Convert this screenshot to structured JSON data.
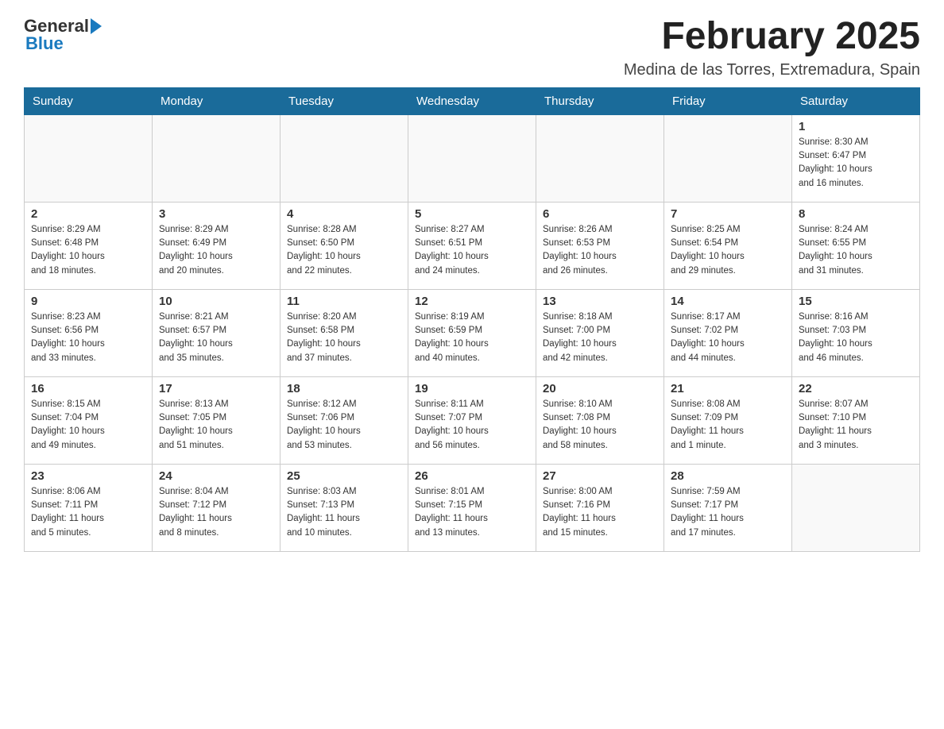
{
  "header": {
    "logo_general": "General",
    "logo_blue": "Blue",
    "title": "February 2025",
    "subtitle": "Medina de las Torres, Extremadura, Spain"
  },
  "calendar": {
    "days_of_week": [
      "Sunday",
      "Monday",
      "Tuesday",
      "Wednesday",
      "Thursday",
      "Friday",
      "Saturday"
    ],
    "weeks": [
      [
        {
          "day": "",
          "info": ""
        },
        {
          "day": "",
          "info": ""
        },
        {
          "day": "",
          "info": ""
        },
        {
          "day": "",
          "info": ""
        },
        {
          "day": "",
          "info": ""
        },
        {
          "day": "",
          "info": ""
        },
        {
          "day": "1",
          "info": "Sunrise: 8:30 AM\nSunset: 6:47 PM\nDaylight: 10 hours\nand 16 minutes."
        }
      ],
      [
        {
          "day": "2",
          "info": "Sunrise: 8:29 AM\nSunset: 6:48 PM\nDaylight: 10 hours\nand 18 minutes."
        },
        {
          "day": "3",
          "info": "Sunrise: 8:29 AM\nSunset: 6:49 PM\nDaylight: 10 hours\nand 20 minutes."
        },
        {
          "day": "4",
          "info": "Sunrise: 8:28 AM\nSunset: 6:50 PM\nDaylight: 10 hours\nand 22 minutes."
        },
        {
          "day": "5",
          "info": "Sunrise: 8:27 AM\nSunset: 6:51 PM\nDaylight: 10 hours\nand 24 minutes."
        },
        {
          "day": "6",
          "info": "Sunrise: 8:26 AM\nSunset: 6:53 PM\nDaylight: 10 hours\nand 26 minutes."
        },
        {
          "day": "7",
          "info": "Sunrise: 8:25 AM\nSunset: 6:54 PM\nDaylight: 10 hours\nand 29 minutes."
        },
        {
          "day": "8",
          "info": "Sunrise: 8:24 AM\nSunset: 6:55 PM\nDaylight: 10 hours\nand 31 minutes."
        }
      ],
      [
        {
          "day": "9",
          "info": "Sunrise: 8:23 AM\nSunset: 6:56 PM\nDaylight: 10 hours\nand 33 minutes."
        },
        {
          "day": "10",
          "info": "Sunrise: 8:21 AM\nSunset: 6:57 PM\nDaylight: 10 hours\nand 35 minutes."
        },
        {
          "day": "11",
          "info": "Sunrise: 8:20 AM\nSunset: 6:58 PM\nDaylight: 10 hours\nand 37 minutes."
        },
        {
          "day": "12",
          "info": "Sunrise: 8:19 AM\nSunset: 6:59 PM\nDaylight: 10 hours\nand 40 minutes."
        },
        {
          "day": "13",
          "info": "Sunrise: 8:18 AM\nSunset: 7:00 PM\nDaylight: 10 hours\nand 42 minutes."
        },
        {
          "day": "14",
          "info": "Sunrise: 8:17 AM\nSunset: 7:02 PM\nDaylight: 10 hours\nand 44 minutes."
        },
        {
          "day": "15",
          "info": "Sunrise: 8:16 AM\nSunset: 7:03 PM\nDaylight: 10 hours\nand 46 minutes."
        }
      ],
      [
        {
          "day": "16",
          "info": "Sunrise: 8:15 AM\nSunset: 7:04 PM\nDaylight: 10 hours\nand 49 minutes."
        },
        {
          "day": "17",
          "info": "Sunrise: 8:13 AM\nSunset: 7:05 PM\nDaylight: 10 hours\nand 51 minutes."
        },
        {
          "day": "18",
          "info": "Sunrise: 8:12 AM\nSunset: 7:06 PM\nDaylight: 10 hours\nand 53 minutes."
        },
        {
          "day": "19",
          "info": "Sunrise: 8:11 AM\nSunset: 7:07 PM\nDaylight: 10 hours\nand 56 minutes."
        },
        {
          "day": "20",
          "info": "Sunrise: 8:10 AM\nSunset: 7:08 PM\nDaylight: 10 hours\nand 58 minutes."
        },
        {
          "day": "21",
          "info": "Sunrise: 8:08 AM\nSunset: 7:09 PM\nDaylight: 11 hours\nand 1 minute."
        },
        {
          "day": "22",
          "info": "Sunrise: 8:07 AM\nSunset: 7:10 PM\nDaylight: 11 hours\nand 3 minutes."
        }
      ],
      [
        {
          "day": "23",
          "info": "Sunrise: 8:06 AM\nSunset: 7:11 PM\nDaylight: 11 hours\nand 5 minutes."
        },
        {
          "day": "24",
          "info": "Sunrise: 8:04 AM\nSunset: 7:12 PM\nDaylight: 11 hours\nand 8 minutes."
        },
        {
          "day": "25",
          "info": "Sunrise: 8:03 AM\nSunset: 7:13 PM\nDaylight: 11 hours\nand 10 minutes."
        },
        {
          "day": "26",
          "info": "Sunrise: 8:01 AM\nSunset: 7:15 PM\nDaylight: 11 hours\nand 13 minutes."
        },
        {
          "day": "27",
          "info": "Sunrise: 8:00 AM\nSunset: 7:16 PM\nDaylight: 11 hours\nand 15 minutes."
        },
        {
          "day": "28",
          "info": "Sunrise: 7:59 AM\nSunset: 7:17 PM\nDaylight: 11 hours\nand 17 minutes."
        },
        {
          "day": "",
          "info": ""
        }
      ]
    ]
  }
}
